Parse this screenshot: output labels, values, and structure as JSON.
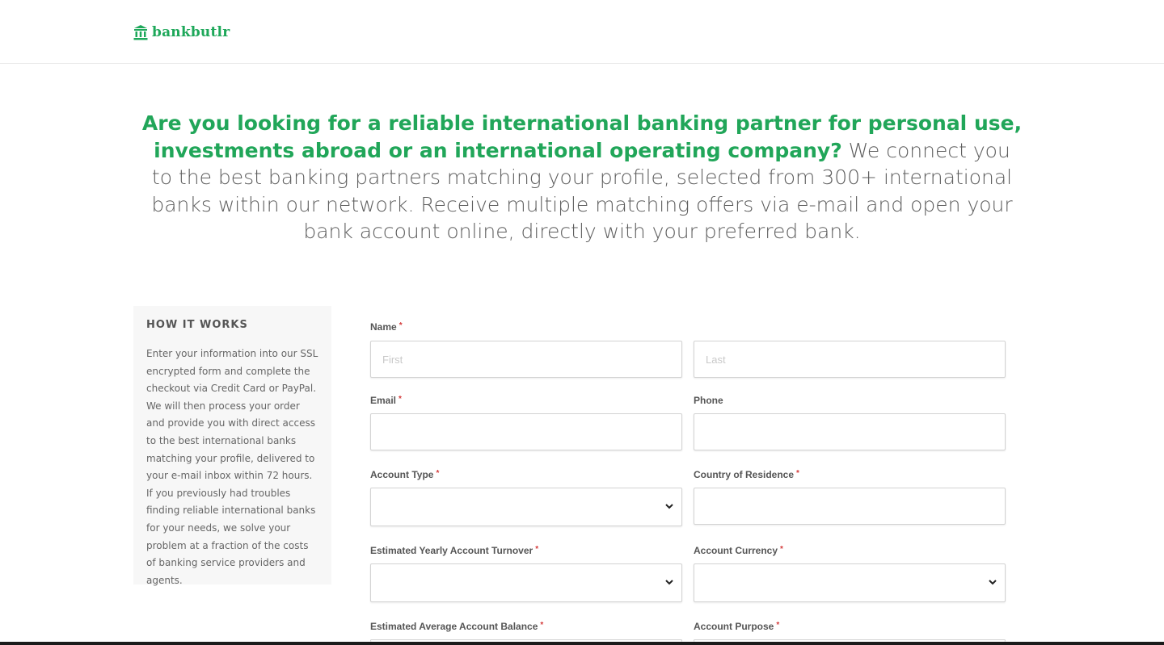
{
  "brand": {
    "name": "bankbutlr",
    "icon": "bank-icon",
    "color": "#1ea85a"
  },
  "hero": {
    "highlight": "Are you looking for a reliable international banking partner for personal use, investments abroad or an international operating company?",
    "body": " We connect you to the best banking partners matching your profile, selected from 300+ international banks within our network. Receive multiple matching offers via e-mail and open your bank account online, directly with your preferred bank."
  },
  "how_it_works": {
    "title": "HOW IT WORKS",
    "text": "Enter your information into our SSL encrypted form and complete the checkout via Credit Card or PayPal. We will then process your order and provide you with direct access to the best international banks matching your profile, delivered to your e-mail inbox within 72 hours. If you previously had troubles finding reliable international banks for your needs, we solve your problem at a fraction of the costs of banking service providers and agents."
  },
  "form": {
    "required_mark": "*",
    "name_label": "Name",
    "first_placeholder": "First",
    "last_placeholder": "Last",
    "email_label": "Email",
    "phone_label": "Phone",
    "account_type_label": "Account Type",
    "country_label": "Country of Residence",
    "turnover_label": "Estimated Yearly Account Turnover",
    "currency_label": "Account Currency",
    "balance_label": "Estimated Average Account Balance",
    "purpose_label": "Account Purpose"
  },
  "colors": {
    "accent": "#21a659",
    "required": "#d43b3b"
  }
}
